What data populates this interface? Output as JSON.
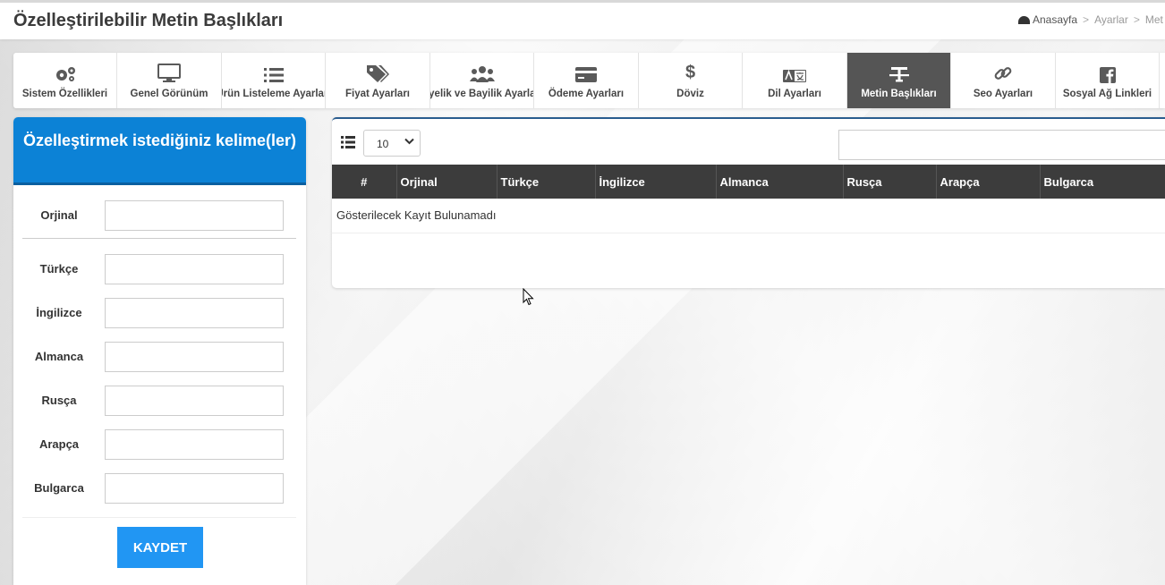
{
  "header": {
    "title": "Özelleştirilebilir Metin Başlıkları",
    "breadcrumb": [
      "Anasayfa",
      "Ayarlar",
      "Met"
    ]
  },
  "tabs": [
    {
      "label": "Sistem Özellikleri",
      "icon": "gears-icon"
    },
    {
      "label": "Genel Görünüm",
      "icon": "monitor-icon"
    },
    {
      "label": "Ürün Listeleme Ayarları",
      "icon": "list-icon"
    },
    {
      "label": "Fiyat Ayarları",
      "icon": "tags-icon"
    },
    {
      "label": "Üyelik ve Bayilik Ayarları",
      "icon": "users-icon"
    },
    {
      "label": "Ödeme Ayarları",
      "icon": "credit-card-icon"
    },
    {
      "label": "Döviz",
      "icon": "dollar-icon"
    },
    {
      "label": "Dil Ayarları",
      "icon": "language-icon"
    },
    {
      "label": "Metin Başlıkları",
      "icon": "text-icon",
      "active": true
    },
    {
      "label": "Seo Ayarları",
      "icon": "link-icon"
    },
    {
      "label": "Sosyal Ağ Linkleri",
      "icon": "facebook-icon"
    }
  ],
  "form": {
    "title": "Özelleştirmek istediğiniz kelime(ler)",
    "fields": {
      "original": {
        "label": "Orjinal",
        "value": ""
      },
      "turkish": {
        "label": "Türkçe",
        "value": ""
      },
      "english": {
        "label": "İngilizce",
        "value": ""
      },
      "german": {
        "label": "Almanca",
        "value": ""
      },
      "russian": {
        "label": "Rusça",
        "value": ""
      },
      "arabic": {
        "label": "Arapça",
        "value": ""
      },
      "bulgarian": {
        "label": "Bulgarca",
        "value": ""
      }
    },
    "save_label": "KAYDET"
  },
  "table": {
    "page_size": "10",
    "columns": [
      "#",
      "Orjinal",
      "Türkçe",
      "İngilizce",
      "Almanca",
      "Rusça",
      "Arapça",
      "Bulgarca"
    ],
    "empty_message": "Gösterilecek Kayıt Bulunamadı"
  },
  "colors": {
    "accent": "#0c82d6",
    "button": "#2196f3",
    "active_tab": "#555555",
    "table_header": "#3c3c3c"
  }
}
